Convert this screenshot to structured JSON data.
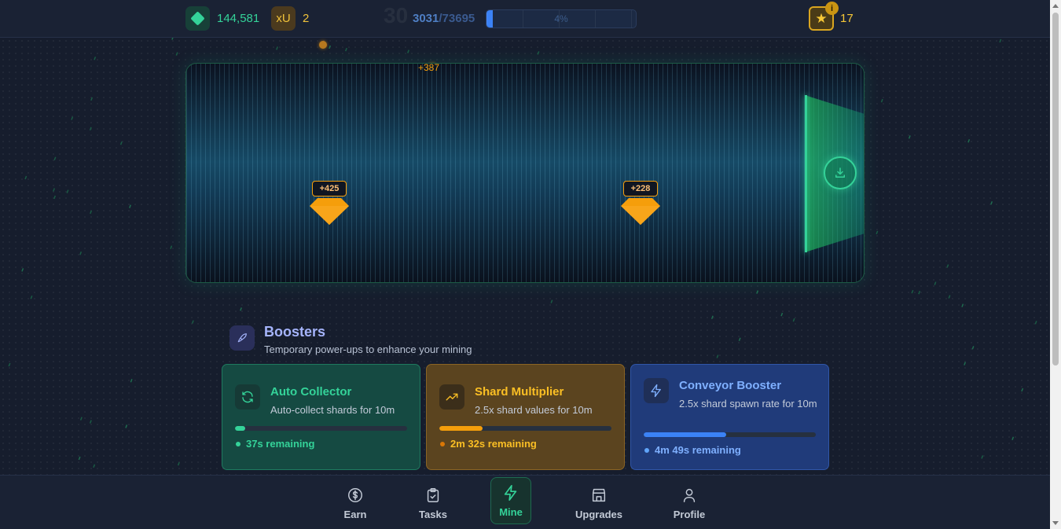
{
  "topbar": {
    "gem_count": "144,581",
    "xu_label": "xU",
    "xu_count": "2",
    "ghost_number": "30",
    "progress_current": "3031",
    "progress_separator": "/",
    "progress_total": "73695",
    "progress_percent_label": "4%",
    "progress_fraction": 0.04,
    "star_count": "17",
    "info_badge": "i",
    "accent_green": "#34d399",
    "accent_gold": "#f6c737"
  },
  "mine": {
    "floating_gain": "+387",
    "shards": [
      {
        "value": "+425",
        "icon": "diamond-shard-icon"
      },
      {
        "value": "+228",
        "icon": "diamond-shard-icon"
      }
    ],
    "collector_icon": "download-icon"
  },
  "boosters": {
    "title": "Boosters",
    "subtitle": "Temporary power-ups to enhance your mining",
    "icon": "rocket-icon",
    "cards": [
      {
        "title": "Auto Collector",
        "description": "Auto-collect shards for 10m",
        "status": "37s remaining",
        "progress": 0.06,
        "icon": "refresh-icon",
        "color": "#34d399"
      },
      {
        "title": "Shard Multiplier",
        "description": "2.5x shard values for 10m",
        "status": "2m 32s remaining",
        "progress": 0.25,
        "icon": "trending-up-icon",
        "color": "#fbbf24"
      },
      {
        "title": "Conveyor Booster",
        "description": "2.5x shard spawn rate for 10m",
        "status": "4m 49s remaining",
        "progress": 0.48,
        "icon": "lightning-icon",
        "color": "#7fb0ff"
      }
    ]
  },
  "nav": {
    "items": [
      {
        "label": "Earn",
        "icon": "dollar-icon"
      },
      {
        "label": "Tasks",
        "icon": "clipboard-icon"
      },
      {
        "label": "Mine",
        "icon": "lightning-icon",
        "active": true
      },
      {
        "label": "Upgrades",
        "icon": "store-icon"
      },
      {
        "label": "Profile",
        "icon": "user-icon"
      }
    ]
  }
}
